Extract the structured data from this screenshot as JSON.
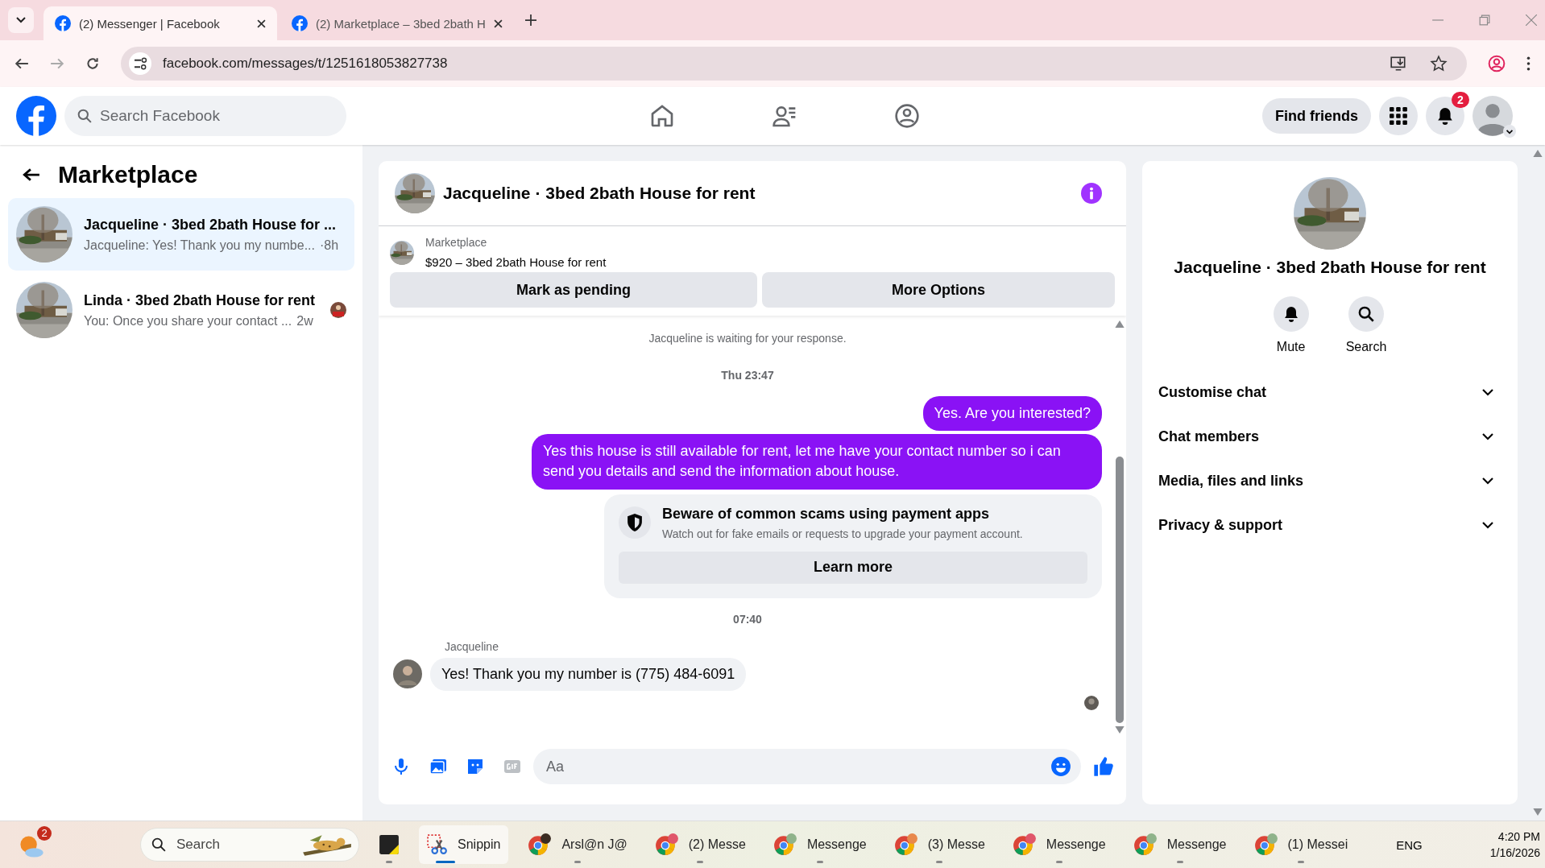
{
  "browser": {
    "tabs": [
      {
        "title": "(2) Messenger | Facebook",
        "selected": true
      },
      {
        "title": "(2) Marketplace – 3bed 2bath H",
        "selected": false
      }
    ],
    "url": "facebook.com/messages/t/1251618053827738"
  },
  "header": {
    "search_placeholder": "Search Facebook",
    "find_friends": "Find friends",
    "notification_count": "2"
  },
  "sidebar": {
    "title": "Marketplace",
    "threads": [
      {
        "title": "Jacqueline · 3bed 2bath House for ...",
        "preview": "Jacqueline: Yes! Thank you my numbe...",
        "time": "·8h",
        "selected": true,
        "seen_by": false
      },
      {
        "title": "Linda · 3bed 2bath House for rent",
        "preview": "You: Once you share your contact ...",
        "time": "2w",
        "selected": false,
        "seen_by": true
      }
    ]
  },
  "chat": {
    "title": "Jacqueline · 3bed 2bath House for rent",
    "listing": {
      "label": "Marketplace",
      "item": "$920 – 3bed 2bath House for rent"
    },
    "actions": [
      "Mark as pending",
      "More Options"
    ],
    "messages": [
      {
        "kind": "notice",
        "text": "Jacqueline is waiting for your response."
      },
      {
        "kind": "time",
        "text": "Thu 23:47"
      },
      {
        "kind": "sent",
        "text": "Yes. Are you interested?"
      },
      {
        "kind": "sent",
        "text": "Yes this house is still available for rent, let me have your contact number so i can send you details and send the information about house."
      },
      {
        "kind": "warning",
        "title": "Beware of common scams using payment apps",
        "text": "Watch out for fake emails or requests to upgrade your payment account.",
        "button": "Learn more"
      },
      {
        "kind": "time",
        "text": "07:40"
      },
      {
        "kind": "sender",
        "text": "Jacqueline"
      },
      {
        "kind": "received",
        "text": "Yes! Thank you my number is (775) 484-6091"
      }
    ],
    "composer_placeholder": "Aa"
  },
  "details": {
    "title": "Jacqueline · 3bed 2bath House for rent",
    "actions": [
      {
        "kind": "mute",
        "label": "Mute"
      },
      {
        "kind": "search",
        "label": "Search"
      }
    ],
    "sections": [
      "Customise chat",
      "Chat members",
      "Media, files and links",
      "Privacy & support"
    ]
  },
  "taskbar": {
    "weather_badge": "2",
    "search_placeholder": "Search",
    "apps": [
      {
        "kind": "notes",
        "selected": false
      },
      {
        "kind": "snip",
        "label": "Snippin",
        "selected": true
      },
      {
        "kind": "browser",
        "label": "Arsl@n J@",
        "selected": false,
        "color": "#3b2c22"
      },
      {
        "kind": "browser",
        "label": "(2) Messe",
        "selected": false,
        "color": "#e0566a"
      },
      {
        "kind": "browser",
        "label": "Messenge",
        "selected": false,
        "color": "#8fb38a"
      },
      {
        "kind": "browser",
        "label": "(3) Messe",
        "selected": false,
        "color": "#e8884c"
      },
      {
        "kind": "browser",
        "label": "Messenge",
        "selected": false,
        "color": "#e0566a"
      },
      {
        "kind": "browser",
        "label": "Messenge",
        "selected": false,
        "color": "#8fb38a"
      },
      {
        "kind": "browser",
        "label": "(1) Messei",
        "selected": false,
        "color": "#8fb38a"
      }
    ],
    "language": "ENG",
    "time": "4:20 PM",
    "date": "1/16/2026"
  }
}
